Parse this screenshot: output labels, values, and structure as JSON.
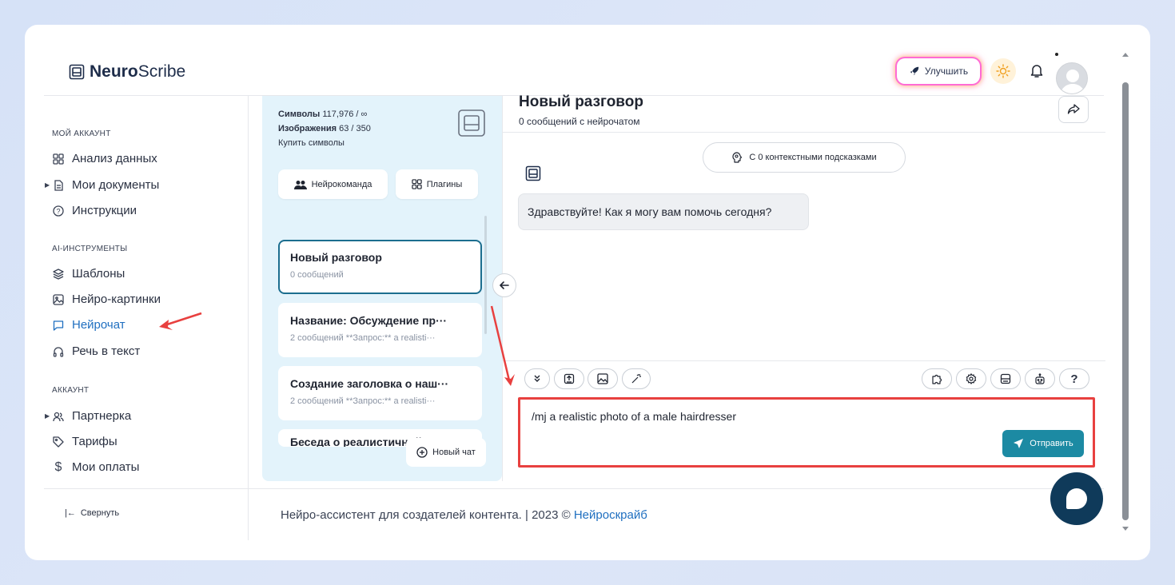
{
  "brand": {
    "bold": "Neuro",
    "rest": "Scribe"
  },
  "header": {
    "upgrade_label": "Улучшить"
  },
  "sidebar": {
    "sections": [
      {
        "title": "МОЙ АККАУНТ"
      },
      {
        "title": "AI-ИНСТРУМЕНТЫ"
      },
      {
        "title": "АККАУНТ"
      }
    ],
    "items": [
      {
        "label": "Анализ данных",
        "icon": "grid-icon"
      },
      {
        "label": "Мои документы",
        "icon": "document-icon"
      },
      {
        "label": "Инструкции",
        "icon": "help-circle-icon"
      },
      {
        "label": "Шаблоны",
        "icon": "layers-icon"
      },
      {
        "label": "Нейро-картинки",
        "icon": "image-icon"
      },
      {
        "label": "Нейрочат",
        "icon": "chat-icon",
        "active": true
      },
      {
        "label": "Речь в текст",
        "icon": "headphones-icon"
      },
      {
        "label": "Партнерка",
        "icon": "users-icon"
      },
      {
        "label": "Тарифы",
        "icon": "tag-icon"
      },
      {
        "label": "Мои оплаты",
        "icon": "dollar-icon"
      }
    ],
    "collapse_label": "Свернуть"
  },
  "panel": {
    "symbols_label": "Символы",
    "symbols_value": "117,976 / ∞",
    "images_label": "Изображения",
    "images_value": "63 / 350",
    "buy_label": "Купить символы",
    "team_label": "Нейрокоманда",
    "plugins_label": "Плагины",
    "chats": [
      {
        "title": "Новый разговор",
        "sub": "0 сообщений"
      },
      {
        "title": "Название: Обсуждение пр···",
        "sub": "2 сообщений   **Запрос:** a realisti···"
      },
      {
        "title": "Создание заголовка о наш···",
        "sub": "2 сообщений   **Запрос:** a realisti···"
      },
      {
        "title": "Беседа о реалистичной фо···",
        "sub": ""
      }
    ],
    "new_chat_label": "Новый чат"
  },
  "chat": {
    "title": "Новый разговор",
    "subtitle": "0 сообщений с нейрочатом",
    "context_label": "С 0 контекстными подсказками",
    "greeting": "Здравствуйте! Как я могу вам помочь сегодня?",
    "input_value": "/mj a realistic photo of a male hairdresser",
    "send_label": "Отправить"
  },
  "footer": {
    "text": "Нейро-ассистент для создателей контента.  | 2023 © ",
    "link": "Нейроскрайб"
  },
  "colors": {
    "accent": "#1c8aa3",
    "active_nav": "#1f6fc0",
    "annotation": "#e8403f",
    "panel_bg": "#e3f3fb"
  }
}
